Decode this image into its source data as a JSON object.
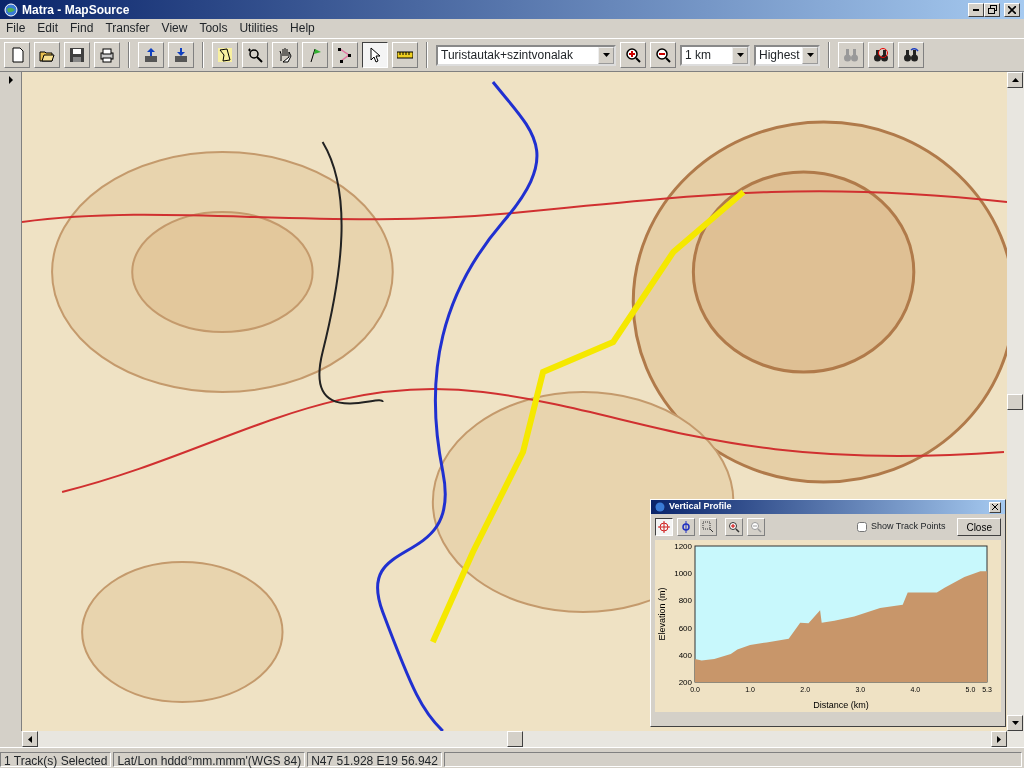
{
  "window": {
    "title": "Matra - MapSource"
  },
  "menu": [
    "File",
    "Edit",
    "Find",
    "Transfer",
    "View",
    "Tools",
    "Utilities",
    "Help"
  ],
  "toolbar": {
    "map_product": "Turistautak+szintvonalak",
    "zoom": "1 km",
    "detail": "Highest",
    "tools": [
      {
        "kind": "new",
        "selected": false
      },
      {
        "kind": "open",
        "selected": false
      },
      {
        "kind": "save",
        "selected": false
      },
      {
        "kind": "print",
        "selected": false
      },
      {
        "kind": "sep"
      },
      {
        "kind": "send",
        "selected": false
      },
      {
        "kind": "receive",
        "selected": false
      },
      {
        "kind": "sep"
      },
      {
        "kind": "mapsel",
        "selected": false
      },
      {
        "kind": "zoomtool",
        "selected": false
      },
      {
        "kind": "hand",
        "selected": false
      },
      {
        "kind": "flag",
        "selected": false
      },
      {
        "kind": "route",
        "selected": false
      },
      {
        "kind": "pointer",
        "selected": true
      },
      {
        "kind": "ruler",
        "selected": false
      }
    ]
  },
  "profile": {
    "title": "Vertical Profile",
    "show_points": {
      "label": "Show Track Points",
      "checked": false
    },
    "close": "Close",
    "chart_data": {
      "type": "area",
      "xlabel": "Distance (km)",
      "ylabel": "Elevation (m)",
      "x": [
        0,
        0.12,
        0.35,
        0.65,
        0.77,
        1.0,
        1.3,
        1.7,
        1.91,
        2.06,
        2.27,
        2.3,
        2.53,
        2.89,
        3.36,
        3.77,
        3.86,
        4.39,
        4.53,
        4.89,
        5.18,
        5.3
      ],
      "series": [
        {
          "color": "#c8966a",
          "values": [
            370,
            359,
            370,
            405,
            439,
            473,
            491,
            518,
            636,
            632,
            727,
            636,
            650,
            682,
            745,
            768,
            859,
            859,
            893,
            973,
            1014,
            1014
          ]
        }
      ],
      "xlim": [
        0,
        5.3
      ],
      "ylim": [
        200,
        1200
      ],
      "xticks": [
        {
          "value": 0,
          "label": "0.0"
        },
        {
          "value": 1,
          "label": "1.0"
        },
        {
          "value": 2,
          "label": "2.0"
        },
        {
          "value": 3,
          "label": "3.0"
        },
        {
          "value": 4,
          "label": "4.0"
        },
        {
          "value": 5,
          "label": "5.0"
        },
        {
          "value": 5.3,
          "label": "5.3"
        }
      ],
      "yticks": [
        200,
        400,
        600,
        800,
        1000,
        1200
      ]
    }
  },
  "status_bar": [
    "1 Track(s) Selected",
    "Lat/Lon hddd°mm.mmm'(WGS 84)",
    "N47 51.928 E19 56.942"
  ]
}
